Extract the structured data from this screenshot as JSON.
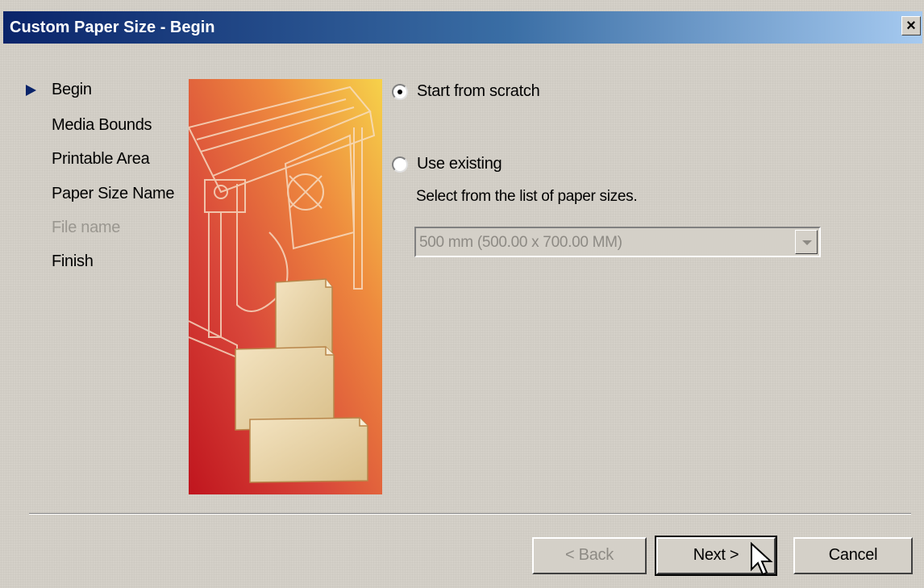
{
  "window": {
    "title": "Custom Paper Size - Begin",
    "close_label": "×"
  },
  "steps": [
    {
      "label": "Begin",
      "current": true,
      "enabled": true
    },
    {
      "label": "Media Bounds",
      "current": false,
      "enabled": true
    },
    {
      "label": "Printable Area",
      "current": false,
      "enabled": true
    },
    {
      "label": "Paper Size Name",
      "current": false,
      "enabled": true
    },
    {
      "label": "File name",
      "current": false,
      "enabled": false
    },
    {
      "label": "Finish",
      "current": false,
      "enabled": true
    }
  ],
  "options": {
    "start_from_scratch": {
      "label": "Start from scratch",
      "selected": true
    },
    "use_existing": {
      "label": "Use existing",
      "selected": false
    },
    "hint": "Select from the list of paper sizes.",
    "paper_size_select": {
      "value": "500 mm (500.00 x 700.00 MM)",
      "enabled": false
    }
  },
  "buttons": {
    "back": "< Back",
    "next": "Next >",
    "cancel": "Cancel"
  },
  "colors": {
    "title_start": "#0a246a",
    "title_end": "#a6caf0",
    "face": "#d4d0c8"
  }
}
